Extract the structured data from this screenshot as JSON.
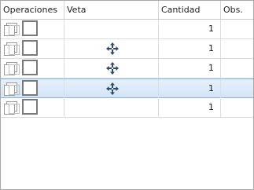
{
  "columns": {
    "operaciones": "Operaciones",
    "veta": "Veta",
    "cantidad": "Cantidad",
    "obs": "Obs."
  },
  "rows": [
    {
      "cantidad": "1",
      "veta_icon": "",
      "selected": false
    },
    {
      "cantidad": "1",
      "veta_icon": "move-icon",
      "selected": false
    },
    {
      "cantidad": "1",
      "veta_icon": "move-icon",
      "selected": false
    },
    {
      "cantidad": "1",
      "veta_icon": "move-icon",
      "selected": true
    },
    {
      "cantidad": "1",
      "veta_icon": "",
      "selected": false
    }
  ],
  "icons": {
    "edit": "edit-icon",
    "delete": "delete-icon",
    "veta": "move-icon"
  },
  "colors": {
    "selected_row": "#d8e7f8",
    "grid_line": "#d9dfe8",
    "icon_blue": "#2f4a6b"
  }
}
